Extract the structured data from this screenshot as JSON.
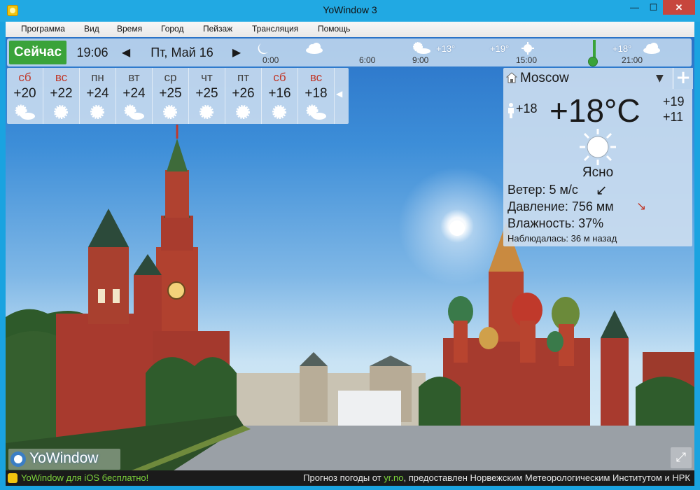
{
  "window": {
    "title": "YoWindow 3",
    "min_label": "—",
    "max_label": "☐",
    "close_label": "✕"
  },
  "menu": [
    "Программа",
    "Вид",
    "Время",
    "Город",
    "Пейзаж",
    "Трансляция",
    "Помощь"
  ],
  "topbar": {
    "now_label": "Сейчас",
    "time": "19:06",
    "date": "Пт, Май 16",
    "prev_label": "◀",
    "next_label": "▶",
    "hour_ticks": [
      "0:00",
      "6:00",
      "9:00",
      "15:00",
      "21:00"
    ],
    "hour_temps": [
      "+13°",
      "+19°",
      "+18°"
    ],
    "icons": [
      "moon-icon",
      "cloud-icon",
      "partly-cloudy-icon",
      "sun-icon",
      "cloud-icon"
    ]
  },
  "forecast": {
    "days": [
      {
        "name": "сб",
        "temp": "+20",
        "weekend": true,
        "icon": "partly-cloudy-icon"
      },
      {
        "name": "вс",
        "temp": "+22",
        "weekend": true,
        "icon": "sun-icon"
      },
      {
        "name": "пн",
        "temp": "+24",
        "weekend": false,
        "icon": "sun-icon"
      },
      {
        "name": "вт",
        "temp": "+24",
        "weekend": false,
        "icon": "partly-cloudy-icon"
      },
      {
        "name": "ср",
        "temp": "+25",
        "weekend": false,
        "icon": "sun-icon"
      },
      {
        "name": "чт",
        "temp": "+25",
        "weekend": false,
        "icon": "sun-icon"
      },
      {
        "name": "пт",
        "temp": "+26",
        "weekend": false,
        "icon": "sun-icon"
      },
      {
        "name": "сб",
        "temp": "+16",
        "weekend": true,
        "icon": "sun-icon"
      },
      {
        "name": "вс",
        "temp": "+18",
        "weekend": true,
        "icon": "partly-cloudy-icon"
      }
    ],
    "collapse_label": "◀"
  },
  "current": {
    "city": "Moscow",
    "dropdown_label": "▼",
    "add_label": "+",
    "feels_like": "+18",
    "temperature": "+18°C",
    "high": "+19",
    "low": "+11",
    "condition": "Ясно",
    "wind": "Ветер:  5 м/с",
    "pressure": "Давление:  756 мм",
    "humidity": "Влажность:  37%",
    "observed": "Наблюдалась:  36 м назад",
    "wind_arrow": "↑",
    "pressure_arrow": "↘"
  },
  "brand": {
    "text": "YoWindow"
  },
  "fullscreen_label": "⤢",
  "status": {
    "left": "YoWindow для iOS бесплатно!",
    "right_prefix": "Прогноз погоды от ",
    "right_link": "yr.no",
    "right_suffix": ", предоставлен Норвежским Метеорологическим Институтом и НРК"
  },
  "colors": {
    "accent": "#3aa33a",
    "weekend": "#c0392b",
    "sky_top": "#2a73c8"
  }
}
